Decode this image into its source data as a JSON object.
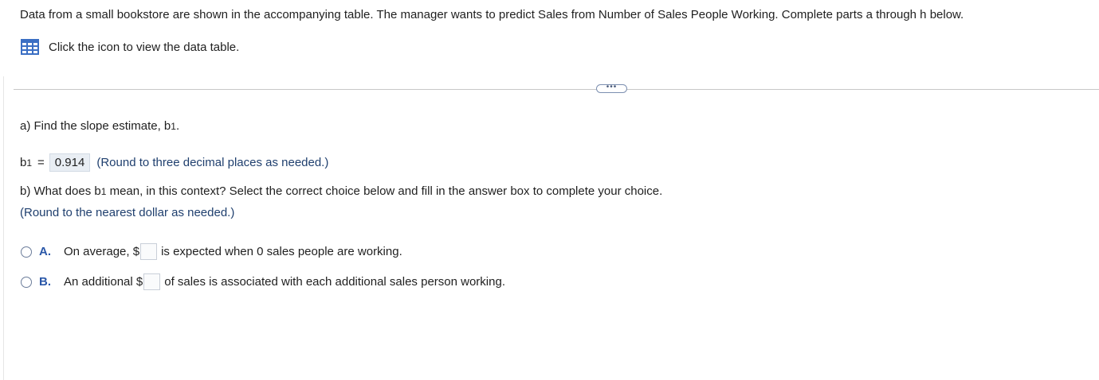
{
  "intro": "Data from a small bookstore are shown in the accompanying table. The manager wants to predict Sales from Number of Sales People Working. Complete parts a through h below.",
  "table_link": {
    "icon": "data-table-icon",
    "label": "Click the icon to view the data table."
  },
  "more_button": {
    "label": "•••"
  },
  "part_a": {
    "prompt_pre": "a) Find the slope estimate, b",
    "prompt_sub": "1",
    "prompt_post": ".",
    "answer_var": "b",
    "answer_sub": "1",
    "equals": "=",
    "answer_value": "0.914",
    "hint": "(Round to three decimal places as needed.)"
  },
  "part_b": {
    "prompt_pre": "b) What does b",
    "prompt_sub": "1",
    "prompt_post": " mean, in this context? Select the correct choice below and fill in the answer box to complete your choice.",
    "hint": "(Round to the nearest dollar as needed.)",
    "choices": [
      {
        "letter": "A.",
        "pre": "On average, $",
        "post": "is expected when 0 sales people are working.",
        "value": ""
      },
      {
        "letter": "B.",
        "pre": "An additional $",
        "post": "of sales is associated with each additional sales person working.",
        "value": ""
      }
    ]
  },
  "colors": {
    "accent": "#2a57a8",
    "icon": "#3b6fc4",
    "hint": "#1f3f6e",
    "answer_bg": "#e9eef4"
  }
}
